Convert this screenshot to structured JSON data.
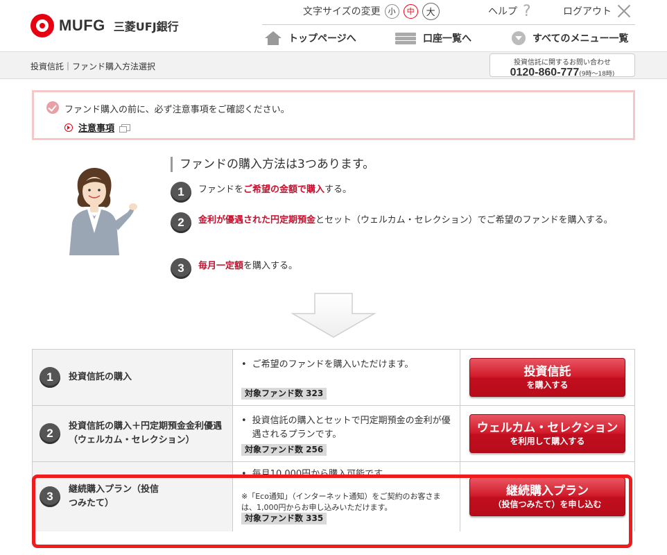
{
  "header": {
    "logo_text": "MUFG",
    "bank_name": "三菱UFJ銀行",
    "font_size_label": "文字サイズの変更",
    "font_sizes": [
      "小",
      "中",
      "大"
    ],
    "help_label": "ヘルプ",
    "logout_label": "ログアウト",
    "nav": {
      "top": "トップページへ",
      "accounts": "口座一覧へ",
      "menu": "すべてのメニュー一覧"
    }
  },
  "breadcrumb": "投資信託｜ファンド購入方法選択",
  "contact": {
    "title": "投資信託に関するお問い合わせ",
    "phone": "0120-860-777",
    "hours": "(9時～18時)"
  },
  "notice": {
    "text": "ファンド購入の前に、必ず注意事項をご確認ください。",
    "link": "注意事項"
  },
  "intro": {
    "heading": "ファンドの購入方法は3つあります。",
    "methods": [
      {
        "num": "1",
        "pre": "ファンドを",
        "em": "ご希望の金額で購入",
        "post": "する。"
      },
      {
        "num": "2",
        "pre": "",
        "em": "金利が優遇された円定期預金",
        "post": "とセット（ウェルカム・セレクション）でご希望のファンドを購入する。"
      },
      {
        "num": "3",
        "pre": "",
        "em": "毎月一定額",
        "post": "を購入する。"
      }
    ]
  },
  "table": {
    "rows": [
      {
        "num": "1",
        "title": "投資信託の購入",
        "desc": "ご希望のファンドを購入いただけます。",
        "note": "",
        "fund_count": "対象ファンド数 323",
        "button_main": "投資信託",
        "button_sub": "を購入する"
      },
      {
        "num": "2",
        "title": "投資信託の購入＋円定期預金金利優遇（ウェルカム・セレクション）",
        "desc": "投資信託の購入とセットで円定期預金の金利が優遇されるプランです。",
        "note": "",
        "fund_count": "対象ファンド数 256",
        "button_main": "ウェルカム・セレクション",
        "button_sub": "を利用して購入する"
      },
      {
        "num": "3",
        "title": "継続購入プラン（投信つみたて）",
        "desc": "毎月10,000円から購入可能です。",
        "note": "※「Eco通知」（インターネット通知）をご契約のお客さまは、1,000円からお申し込みいただけます。",
        "fund_count": "対象ファンド数 335",
        "button_main": "継続購入プラン",
        "button_sub": "（投信つみたて）を申し込む"
      }
    ]
  },
  "colors": {
    "brand_red": "#e60012",
    "button_red": "#c8102e",
    "highlight_red": "#ee1c1c",
    "notice_border": "#f4c7c9"
  }
}
